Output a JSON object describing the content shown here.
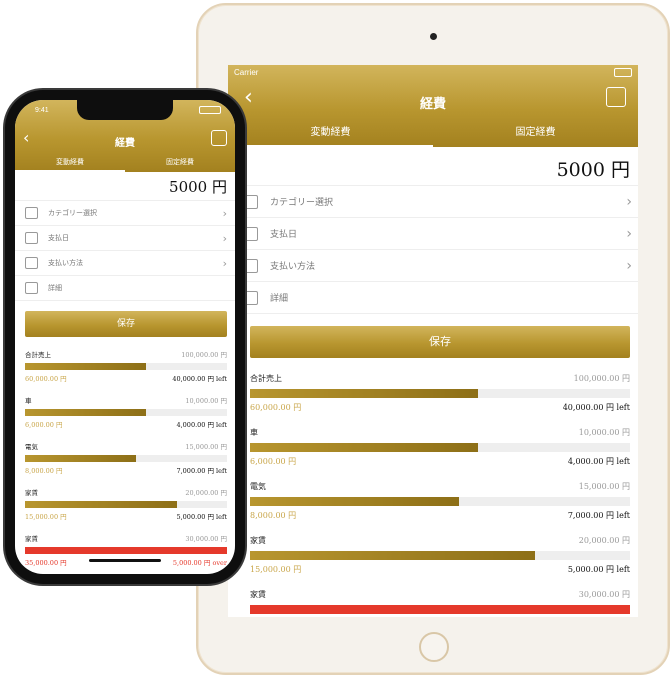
{
  "app": {
    "title": "経費",
    "tabs": [
      "変動経費",
      "固定経費"
    ],
    "amount": "5000 円",
    "carrier": "Carrier",
    "time": "9:41",
    "form_rows": [
      {
        "label": "カテゴリー選択",
        "icon": "list-icon",
        "chevron": true
      },
      {
        "label": "支払日",
        "icon": "calendar-icon",
        "chevron": true
      },
      {
        "label": "支払い方法",
        "icon": "payment-icon",
        "chevron": true
      },
      {
        "label": "詳細",
        "icon": "notes-icon",
        "chevron": false
      }
    ],
    "save_label": "保存",
    "budgets": [
      {
        "name": "合計売上",
        "total": "100,000.00 円",
        "used": "60,000.00 円",
        "remaining": "40,000.00 円 left",
        "progress": 0.6,
        "over": false
      },
      {
        "name": "車",
        "total": "10,000.00 円",
        "used": "6,000.00 円",
        "remaining": "4,000.00 円 left",
        "progress": 0.6,
        "over": false
      },
      {
        "name": "電気",
        "total": "15,000.00 円",
        "used": "8,000.00 円",
        "remaining": "7,000.00 円 left",
        "progress": 0.55,
        "over": false
      },
      {
        "name": "家賃",
        "total": "20,000.00 円",
        "used": "15,000.00 円",
        "remaining": "5,000.00 円 left",
        "progress": 0.75,
        "over": false
      },
      {
        "name": "家賃",
        "total": "30,000.00 円",
        "used": "35,000.00 円",
        "remaining": "5,000.00 円 over",
        "progress": 1.0,
        "over": true
      }
    ]
  },
  "colors": {
    "gold": "#b8962f",
    "over": "#e5392b"
  }
}
